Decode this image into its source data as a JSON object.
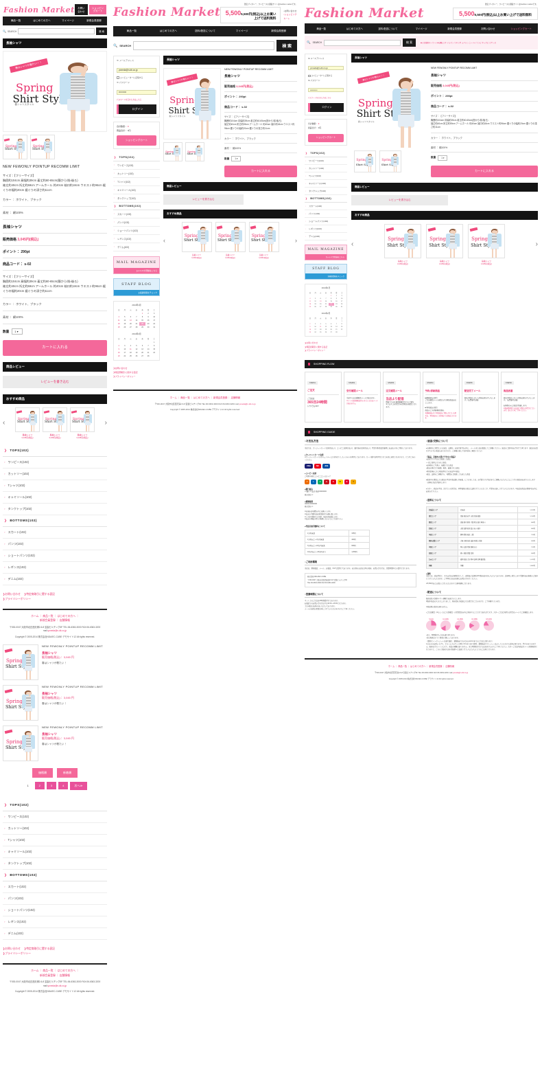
{
  "brand": {
    "name": "Fashion Market"
  },
  "header": {
    "tagline": "激安プレタシー、ワンピースの通販サイトはFashion marketです。",
    "free_shipping": "5,500円(税込)以上お買い上げで送料無料",
    "contact": "お問い合わせ",
    "cart": "ショッピングカート"
  },
  "nav": {
    "items_mobile": [
      "商品一覧",
      "はじめての方へ",
      "マイページ",
      "新規会員登録"
    ],
    "items_tablet": [
      "商品一覧",
      "はじめての方へ",
      "送料・配送について",
      "マイページ",
      "新規会員登録"
    ],
    "items_desktop": [
      "商品一覧",
      "はじめての方へ",
      "送料・配送について",
      "マイページ",
      "新規会員登録",
      "お問い合わせ",
      "ショッピングカート"
    ]
  },
  "search": {
    "label": "SEARCH",
    "placeholder": "",
    "button": "検 索",
    "hotkeys": "◆人気検索キーワード◆ 通販 ミネ ドルマン ワキリボ ふバツン ニーハイ ワンピ ネックピ ミギンス"
  },
  "login": {
    "email_label": "≫ メールアドレス",
    "email_value": "yoneda@n-dk.co.jp",
    "remember_label": "コンピューターに記憶する",
    "password_label": "≫ パスワード",
    "password_value": "••••••••••",
    "forgot": "パスワードを忘れた方はこちら",
    "submit": "ログイン"
  },
  "cartbox": {
    "count_label": "合計数量：",
    "count_value": "0",
    "total_label": "商品合計：",
    "total_value": "0円",
    "button": "ショッピングカート"
  },
  "product": {
    "breadcrumb_title": "長袖シャツ",
    "tags": "NEW  FEWONLY  POINTUP  RECOMM  LIMIT",
    "name": "長袖シャツ",
    "price_label": "販売価格",
    "price_value": "3,045円(税込)",
    "point_label": "ポイント：",
    "point_value": "290pt",
    "code_label": "商品コード：",
    "code_value": "s-02",
    "size_line1": "サイズ：【フリーサイズ】",
    "size_line2": "胸囲約104cm 肩幅約39cm 着丈約60-65cm(簡から/前・後ろ)",
    "size_line3": "袖丈約40cm 裄丈約59cm アームホール 約40cm 袖口約18cm ウエスト約96cm 裾ぐりの幅約20cm 裾ぐりの深さ約11cm",
    "color_label": "カラー ：",
    "color_value": "ホワイト、ブラック",
    "material_label": "素材 ：",
    "material_value": "綿100%",
    "qty_label": "数量",
    "qty_value": "1",
    "add_to_cart": "カートに入れる",
    "image": {
      "ribbon": "春はシャツが着たい！！",
      "title1": "Spring",
      "title2": "Shirt Style",
      "subtitle": "春シャツスタイル"
    }
  },
  "review": {
    "title": "商品レビュー",
    "button": "レビューを書き込む"
  },
  "recommend": {
    "title": "おすすめ商品",
    "prev": "‹",
    "next": "›",
    "items": [
      {
        "name": "長袖シャツ",
        "price": "3,045円(税込)"
      },
      {
        "name": "長袖シャツ",
        "price": "3,045円(税込)"
      },
      {
        "name": "長袖シャツ",
        "price": "3,045円(税込)"
      }
    ]
  },
  "categories": [
    {
      "type": "head",
      "label": "TOPS(102)"
    },
    {
      "type": "item",
      "label": "ワンピース(102)"
    },
    {
      "type": "item",
      "label": "カットソー(102)"
    },
    {
      "type": "item",
      "label": "Tシャツ(102)"
    },
    {
      "type": "item",
      "label": "キャミソール(102)"
    },
    {
      "type": "item",
      "label": "タンクトップ(102)"
    },
    {
      "type": "head",
      "label": "BOTTOMS(102)"
    },
    {
      "type": "item",
      "label": "スカート(102)"
    },
    {
      "type": "item",
      "label": "パンツ(102)"
    },
    {
      "type": "item",
      "label": "ショートパンツ(102)"
    },
    {
      "type": "item",
      "label": "レギンス(102)"
    },
    {
      "type": "item",
      "label": "デニム(102)"
    }
  ],
  "sidelinks": [
    "お問い合わせ",
    "特定商取引に関する表記",
    "プライバシーポリシー"
  ],
  "mailmag": {
    "title": "MAIL MAGAZINE",
    "sub": "メルマガ登録はこちら"
  },
  "staffblog": {
    "title": "STAFF BLOG",
    "sub": "最新情報をチェック"
  },
  "calendars": [
    {
      "caption": "2014年1月",
      "weekdays": [
        "日",
        "月",
        "火",
        "水",
        "木",
        "金",
        "土"
      ],
      "weeks": [
        [
          "",
          "",
          "",
          "",
          "1",
          "2",
          "3"
        ],
        [
          "4",
          "5",
          "6",
          "7",
          "8",
          "9",
          "10"
        ],
        [
          "11",
          "12",
          "13",
          "14",
          "15",
          "16",
          "17"
        ],
        [
          "18",
          "19",
          "20",
          "21",
          "22",
          "23",
          "24"
        ],
        [
          "25",
          "26",
          "27",
          "28",
          "29",
          "30",
          "31"
        ]
      ],
      "highlight": "22"
    },
    {
      "caption": "2014年2月",
      "weekdays": [
        "日",
        "月",
        "火",
        "水",
        "木",
        "金",
        "土"
      ],
      "weeks": [
        [
          "",
          "",
          "",
          "",
          "",
          "",
          "1"
        ],
        [
          "2",
          "3",
          "4",
          "5",
          "6",
          "7",
          "8"
        ],
        [
          "9",
          "10",
          "11",
          "12",
          "13",
          "14",
          "15"
        ],
        [
          "16",
          "17",
          "18",
          "19",
          "20",
          "21",
          "22"
        ],
        [
          "23",
          "24",
          "25",
          "26",
          "27",
          "28",
          ""
        ]
      ],
      "highlight": ""
    }
  ],
  "listing": {
    "items": [
      {
        "tags": "NEW  FEWONLY POINTUP  RECOMM LIMIT",
        "name": "長袖シャツ",
        "price": "販売価格(税込)： 3,045 円",
        "desc": "春はシャツが着たい！"
      },
      {
        "tags": "NEW  FEWONLY POINTUP  RECOMM LIMIT",
        "name": "長袖シャツ",
        "price": "販売価格(税込)： 3,045 円",
        "desc": "春はシャツが着たい！"
      },
      {
        "tags": "NEW  FEWONLY POINTUP  RECOMM LIMIT",
        "name": "長袖シャツ",
        "price": "販売価格(税込)： 3,045 円",
        "desc": "春はシャツが着たい！"
      }
    ],
    "sort": [
      "価格順",
      "新着順"
    ],
    "pages": [
      "1",
      "2",
      "3",
      "4",
      "次へ≫"
    ]
  },
  "shopping_flow": {
    "title": "SHOPPING FLOW",
    "steps": [
      {
        "step": "STEP01",
        "title": "ご注文",
        "body_small": "ご注文は",
        "body_big": "365日24時間",
        "body_tail": "いつでもOK!!"
      },
      {
        "step": "STEP02",
        "title": "受付確認メール",
        "body_small": "当店からの自動配信メールが届きます。",
        "body_warn": "※メール受信制限設定をされている方はメールが届きません。"
      },
      {
        "step": "STEP03",
        "title": "注文確認メール",
        "body_big": "当店より配信",
        "body_small": "問屋下での在庫金額確認などのご案内\n※クロネコの場合が安定期日の配信となります。"
      },
      {
        "step": "STEP04",
        "title": "予約・即納商品",
        "body_small": "■即納商品の場合\nご注文確認メール送信日より順次商品お出しします。\n\n■予約商品の場合\n商品のご入荷後/順次発送。",
        "body_warn": "※即納商品より予約商品をご購入されている場合は、予約商品のご入荷後よりの発送となります。"
      },
      {
        "step": "STEP05",
        "title": "配送完了メール",
        "body_small": "商品が発送しました事をお知らせいたします。（伝票番号記載）"
      },
      {
        "step": "STEP06",
        "title": "商品到着",
        "body_small": "商品が発送しました事をお知らせいたします。（伝票番号記載）\n\nお客様の元に商品が到着します。",
        "body_warn": "※配送業者便でのお届けが異なる場合がございます。あらかじめご了承ください。"
      }
    ]
  },
  "shopping_guide": {
    "title": "SHOPPING GUIDE",
    "left": {
      "pay_title": "○お支払方法",
      "pay_intro": "当店では、クレジットカード決済(先払い)、コンビニ決済(先払い)、銀行振込決済(先払い)、代金引換(商品到着時にお支払い)をご用意しております。",
      "credit_head": "●クレジットカード決済",
      "credit_body": "※クレジットカードのセキュリティに万全を尽くしたシステムを利用しております。カード番号は暗号化されて安全に送信されますので、どうぞご安心ください。",
      "cvs_head": "●コンビニ決済",
      "cvs_body": "ご利用可能なコンビニエンスストア",
      "bank_head": "●銀行振込",
      "bank_body": "××銀行××支店  普通 00000000\n株式会社××",
      "post_head": "●郵便振替",
      "post_body": "00000-00000000\n株式会社××",
      "bank_notes": "※お振込は1週間以内にお願いします。\n※払込み手数料はお客様負担でお願い致します。\n※ご入金が確認でき次第、商品を発送致します。\n※払込み用紙の控えが振替にないようにご注意下さい。",
      "cod_head": "●代金引換手数料について",
      "use_title": "○ご利用環境",
      "use_body": "当店は、携帯電話、メール、お電話、FAXで受付けております。お日様のお店は日本の発送、お問い合わせは、営業時間内での受付となります。",
      "contact_box": "株式会社NDA/JEC-CUBE\n〒530-0047 大阪市北区西天満2-6-8 宝製ビルヂング6F\nTEL:06-6363-3000  FAX:06-6363-3200",
      "hours_title": "○営業時間について",
      "hours_body": "ネット上のご注文は24時間受付けております。\nお電話でのお問い合わせは平日10:00〜18:00となります。\n土日・祝日はお休みをいただいております。\nメールの返信は営業日内にさせていただきますのでご了承ください。"
    },
    "right": {
      "ret_title": "○返品・交換について",
      "ret_body": "●お客様のご都合による返品、交換は、お届け後7日以内に、メールまたはお電話にてご連絡ください。返品のご案内をお合わせて承ります（返品のお受けができない商品もありますので、ご連絡の前に下記内容をご確認ください）",
      "ret_list_title": "【返品、交換をお受けできない商品】",
      "ret_list": [
        "お届けから7日以上経過した商品",
        "一度ご使用になられた商品",
        "お客様のご手違い、破損された商品",
        "商品の傷などが破損、紛失、破棄された商品",
        "特別企画のこれが割高等などの返品不可商品",
        "返品、交換のご連絡から、1週間以上経過しても戻した商品"
      ],
      "ret_note1": "●配送中の事故による商品の不良や商品違いが屋着、につきましては、お手数ですが当店までご連絡いただいた上にごさせの商品をお送りいたします（送料は当店が負担します）",
      "ret_note2": "●万が一、商品の不良、欠けている場合は、同等価格の商品と交換させていただくか、代金をお返しさせていただきます。※返品は商品お事後3日以内にお知らせ下さい。",
      "ship_title": "○送料について",
      "ship_table": [
        {
          "area": "北海道エリア",
          "pref": "北海道",
          "fee": "1,570円"
        },
        {
          "area": "東北エリア",
          "pref": "青森 秋田 岩手 山形 宮城 福島",
          "fee": "1,130円"
        },
        {
          "area": "関東エリア",
          "pref": "茨城 栃木 群馬 千葉 埼玉 東京 神奈川",
          "fee": "840円"
        },
        {
          "area": "信越エリア",
          "pref": "山梨 長野 新潟 富山 石川 福井",
          "fee": "840円"
        },
        {
          "area": "中部エリア",
          "pref": "静岡 愛知 岐阜 三重",
          "fee": "710円"
        },
        {
          "area": "関西・近畿エリア",
          "pref": "大阪 京都 奈良 滋賀 和歌山 兵庫",
          "fee": "630円"
        },
        {
          "area": "中国エリア",
          "pref": "岡山 広島 鳥取 島根 山口",
          "fee": "710円"
        },
        {
          "area": "四国エリア",
          "pref": "香川 徳島 愛媛 高知",
          "fee": "630円"
        },
        {
          "area": "九州エリア",
          "pref": "福岡 佐賀 大分 熊本 長崎 宮崎 鹿児島",
          "fee": "1,070円"
        },
        {
          "area": "沖縄",
          "pref": "沖縄",
          "fee": "1,660円"
        }
      ],
      "fee_head": "●送料",
      "fee_body": "当店では、商品代金と、それ以外の必要料金として、送料及び決済料(3%/税込表示)をいただいております。決済時に発生します手数料はお客様のご負担とさせていただきます。ご不明な点はお気軽にお問い合わせください。",
      "fee_note": "※5,500円以上お買い上げいただきますと送料無料になります。",
      "del_title": "○配送について",
      "del_body": "配送は佐川急便/ヤマト運輸でお届けいたします。\n地域や商品の大きさによりまして、発送会社が変更になる場合がございますが、ご了承願下さいませ。\n\n※発送地の指定は承れません。\n\n・ご注文確認（※もしくはご入金確認）の翌営業日以内に発送することだけであればですが、万が一ご注文が遅れる場合はメールでご連絡致します。",
      "time_label": "時間帯",
      "time_slots": [
        "午前中",
        "12-14時",
        "14-16時",
        "16-18時",
        "18-21時"
      ],
      "del_note": "・また、時間指定も上記の通り承ります。\n・当日発送はヤマト便・佐川便にしております。\n（簡単なレンクレジット決済か銀行、郵便振込でも1点のみ(2cm)までのご注文に限ります）\n1点のみのお買い上げで、ポストに入るサイズ(厚さ2cmまで)まで便利、郵便振込かクレジット払いしていただける決済に限ります。代引きはできません。配達はポストインになり、商品の補償はありません。また時間指定なども出来ませんのでご了承ください。万が一ご注文内商品がメール便規格外となりますと、こちらで配送方法を宅配便へと変更させていただいたようでのご出荷となります。"
    }
  },
  "footer": {
    "links": [
      "ホーム",
      "商品一覧",
      "はじめての方へ",
      "新規会員登録",
      "店舗情報"
    ],
    "address": "〒530-0047 大阪市北区西天満2-6-8 宝製ビルヂング6F TEL:06-6363-3000 FAX:06-6363-3200 mail:",
    "mail": "yoneda@n-dk.co.jp",
    "copyright": "Copyright © 2005-2014 株式会社NDA/EC-CUBE デモサイト12 All rights reserved."
  },
  "colors": {
    "accent_pink": "#e8316c",
    "button_pink": "#f4689a",
    "nav_dark": "#1c1c1c",
    "section_black": "#141414"
  }
}
